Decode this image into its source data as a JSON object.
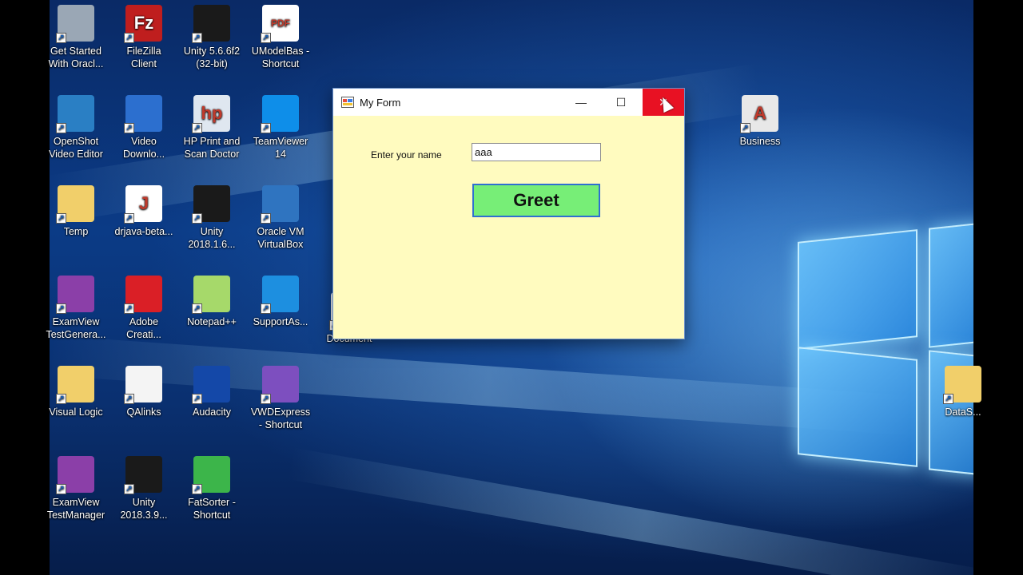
{
  "desktop": {
    "icons": [
      {
        "label": "Get Started\nWith Oracl...",
        "icon": "database-icon",
        "color": "#9aa7b5"
      },
      {
        "label": "FileZilla\nClient",
        "icon": "filezilla-icon",
        "color": "#bf1e1e",
        "glyph": "Fz"
      },
      {
        "label": "Unity 5.6.6f2\n(32-bit)",
        "icon": "unity-icon",
        "color": "#1a1a1a"
      },
      {
        "label": "UModelBas -\nShortcut",
        "icon": "pdf-icon",
        "color": "#ffffff",
        "glyph": "PDF"
      },
      {
        "label": "OpenShot\nVideo Editor",
        "icon": "openshot-icon",
        "color": "#2a7fc4"
      },
      {
        "label": "Video\nDownlo...",
        "icon": "video-download-icon",
        "color": "#2c6fcf"
      },
      {
        "label": "HP Print and\nScan Doctor",
        "icon": "hp-icon",
        "color": "#dfe7f0",
        "glyph": "hp"
      },
      {
        "label": "TeamViewer\n14",
        "icon": "teamviewer-icon",
        "color": "#0e8ee9"
      },
      {
        "label": "Temp",
        "icon": "folder-icon",
        "color": "#f1cf6a"
      },
      {
        "label": "drjava-beta...",
        "icon": "drjava-icon",
        "color": "#ffffff",
        "glyph": "J"
      },
      {
        "label": "Unity\n2018.1.6...",
        "icon": "unity-icon",
        "color": "#1a1a1a"
      },
      {
        "label": "Oracle VM\nVirtualBox",
        "icon": "virtualbox-icon",
        "color": "#2f74c0"
      },
      {
        "label": "ExamView\nTestGenera...",
        "icon": "examview-icon",
        "color": "#8b3fa8"
      },
      {
        "label": "Adobe\nCreati...",
        "icon": "adobe-cc-icon",
        "color": "#da1f26"
      },
      {
        "label": "Notepad++",
        "icon": "notepadpp-icon",
        "color": "#a6d96a"
      },
      {
        "label": "SupportAs...",
        "icon": "support-assist-icon",
        "color": "#1d8fe0"
      },
      {
        "label": "Visual Logic",
        "icon": "folder-icon",
        "color": "#f1cf6a"
      },
      {
        "label": "QAlinks",
        "icon": "text-file-icon",
        "color": "#f4f4f4"
      },
      {
        "label": "Audacity",
        "icon": "audacity-icon",
        "color": "#1448a8"
      },
      {
        "label": "VWDExpress\n- Shortcut",
        "icon": "vwd-express-icon",
        "color": "#7d4fbf"
      },
      {
        "label": "ExamView\nTestManager",
        "icon": "examview-icon",
        "color": "#8b3fa8"
      },
      {
        "label": "Unity\n2018.3.9...",
        "icon": "unity-icon",
        "color": "#1a1a1a"
      },
      {
        "label": "FatSorter -\nShortcut",
        "icon": "fatsorter-icon",
        "color": "#3cb54a"
      },
      {
        "label": "Business",
        "icon": "access-icon",
        "color": "#e8e8e8",
        "glyph": "A"
      },
      {
        "label": "Document",
        "icon": "document-icon",
        "color": "#f0f0f0"
      },
      {
        "label": "DataS...",
        "icon": "folder-icon",
        "color": "#f1cf6a"
      }
    ]
  },
  "form": {
    "title": "My Form",
    "minimize_glyph": "—",
    "maximize_glyph": "☐",
    "close_glyph": "✕",
    "name_label": "Enter your name",
    "name_value": "aaa",
    "greet_label": "Greet",
    "background_color": "#fffbbf",
    "button_color": "#77ee77"
  }
}
